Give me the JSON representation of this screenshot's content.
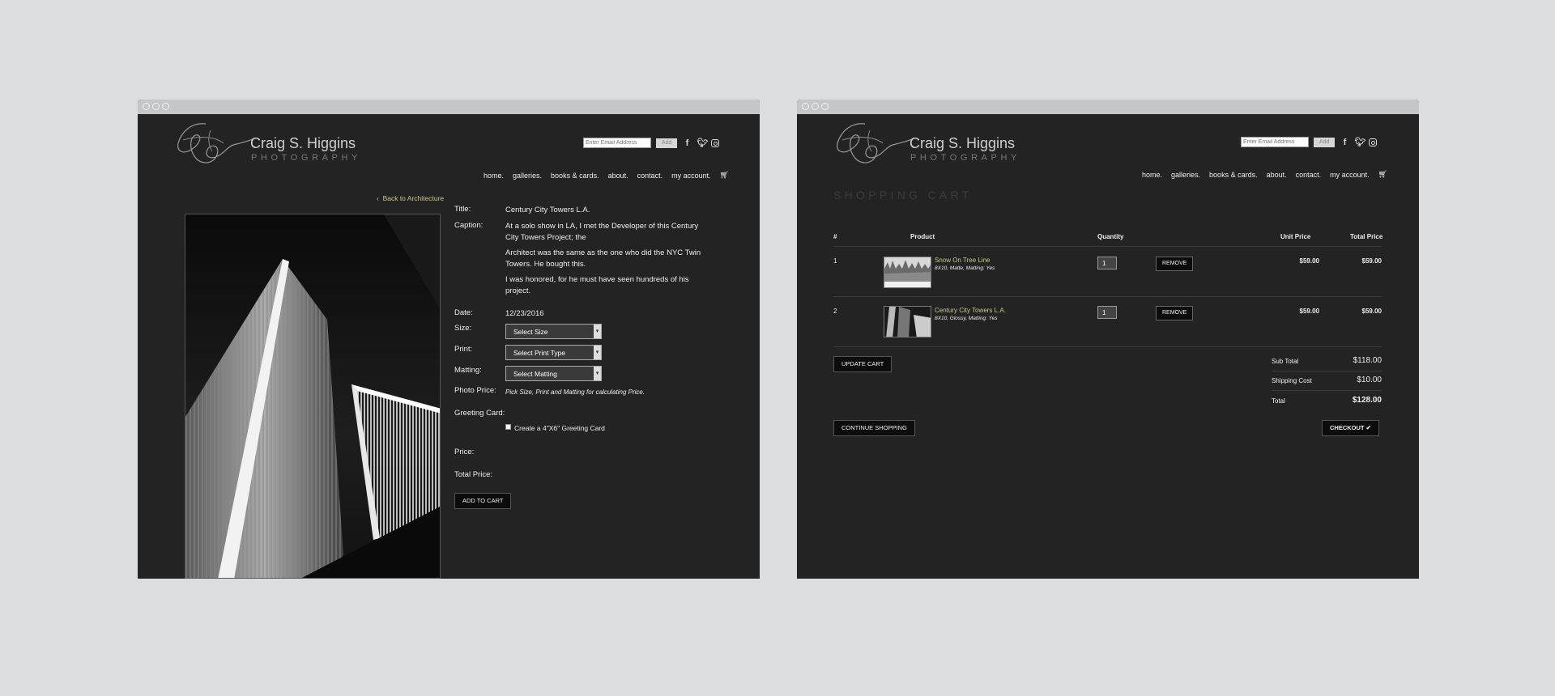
{
  "brand": {
    "name": "Craig S. Higgins",
    "sub": "PHOTOGRAPHY"
  },
  "header": {
    "email_placeholder": "Enter Email Address",
    "add_label": "Add",
    "social": [
      "facebook-icon",
      "twitter-icon",
      "instagram-icon"
    ]
  },
  "nav": [
    "home.",
    "galleries.",
    "books & cards.",
    "about.",
    "contact.",
    "my account."
  ],
  "product_page": {
    "back_link": "Back to Architecture",
    "labels": {
      "title": "Title:",
      "caption": "Caption:",
      "date": "Date:",
      "size": "Size:",
      "print": "Print:",
      "matting": "Matting:",
      "photo_price": "Photo Price:",
      "greeting_card": "Greeting Card:",
      "price": "Price:",
      "total_price": "Total Price:"
    },
    "title": "Century City Towers L.A.",
    "caption": [
      "At a solo show in LA, I met the Developer of this Century City Towers Project; the",
      "Architect was the same as the one who did the NYC Twin Towers.  He bought this.",
      "I was honored, for he must have seen hundreds of his project."
    ],
    "date": "12/23/2016",
    "size_select": "Select Size",
    "print_select": "Select Print Type",
    "matting_select": "Select Matting",
    "photo_price_hint": "Pick Size, Print and Matting for calculating Price.",
    "greeting_option": "Create a 4\"X6\" Greeting Card",
    "add_to_cart": "ADD TO CART"
  },
  "cart_page": {
    "heading": "SHOPPING CART",
    "columns": {
      "num": "#",
      "product": "Product",
      "quantity": "Quantity",
      "unit_price": "Unit Price",
      "total_price": "Total Price"
    },
    "items": [
      {
        "num": "1",
        "name": "Snow On Tree Line",
        "desc": "8X10, Matte, Matting: Yes",
        "qty": "1",
        "remove": "REMOVE",
        "unit": "$59.00",
        "total": "$59.00"
      },
      {
        "num": "2",
        "name": "Century City Towers L.A.",
        "desc": "8X10, Glossy, Matting: Yes",
        "qty": "1",
        "remove": "REMOVE",
        "unit": "$59.00",
        "total": "$59.00"
      }
    ],
    "update_cart": "UPDATE CART",
    "continue_shopping": "CONTINUE SHOPPING",
    "checkout": "CHECKOUT ✔",
    "summary": {
      "subtotal_label": "Sub Total",
      "subtotal": "$118.00",
      "shipping_label": "Shipping Cost",
      "shipping": "$10.00",
      "total_label": "Total",
      "total": "$128.00"
    }
  }
}
